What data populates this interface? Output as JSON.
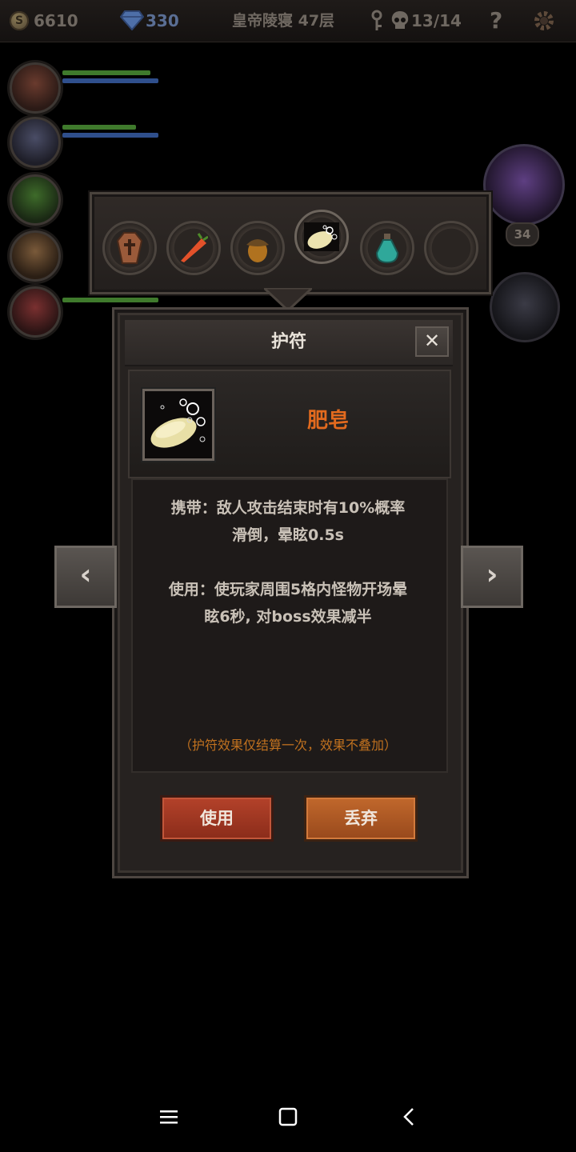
{
  "topbar": {
    "coin_icon": "S",
    "gold": "6610",
    "gems": "330",
    "floor": "皇帝陵寝 47层",
    "kills": "13/14",
    "help": "?"
  },
  "boss_level": "34",
  "amulet_slots": [
    {
      "icon": "coffin-icon",
      "glyph": "⚰"
    },
    {
      "icon": "carrot-icon",
      "glyph": "🥕"
    },
    {
      "icon": "acorn-icon",
      "glyph": "🌰"
    },
    {
      "icon": "soap-icon",
      "glyph": "🧼",
      "selected": true
    },
    {
      "icon": "potion-icon",
      "glyph": "🧪"
    },
    {
      "icon": "empty-slot",
      "glyph": ""
    }
  ],
  "dialog": {
    "title": "护符",
    "close": "✕",
    "item_name": "肥皂",
    "carry_line1": "携带：敌人攻击结束时有10%概率",
    "carry_line2": "滑倒，晕眩0.5s",
    "use_line1": "使用：使玩家周围5格内怪物开场晕",
    "use_line2": "眩6秒, 对boss效果减半",
    "note": "（护符效果仅结算一次，效果不叠加）",
    "use_button": "使用",
    "discard_button": "丢弃"
  },
  "nav": {
    "prev": "‹",
    "next": "›"
  },
  "colors": {
    "accent_orange": "#e26a1e",
    "note_orange": "#c0711f",
    "button_red": "#a53a22"
  }
}
